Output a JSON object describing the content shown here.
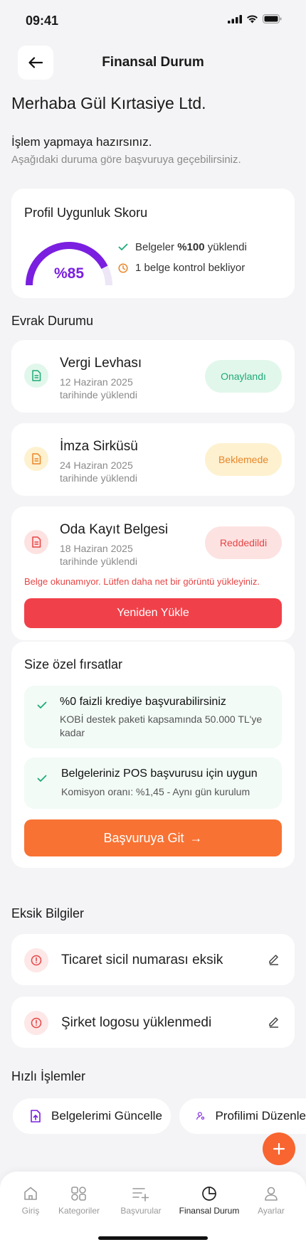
{
  "status": {
    "time": "09:41"
  },
  "header": {
    "title": "Finansal Durum"
  },
  "greeting": "Merhaba Gül Kırtasiye Ltd.",
  "intro": {
    "title": "İşlem yapmaya hazırsınız.",
    "subtitle": "Aşağıdaki duruma göre başvuruya geçebilirsiniz."
  },
  "score": {
    "title": "Profil Uygunluk Skoru",
    "value_label": "%85",
    "value": 0.85,
    "line1_prefix": "Belgeler",
    "line1_bold": "%100",
    "line1_suffix": "yüklendi",
    "line2": "1 belge kontrol bekliyor"
  },
  "documents": {
    "title": "Evrak Durumu",
    "items": [
      {
        "name": "Vergi Levhası",
        "date": "12 Haziran 2025 tarihinde yüklendi",
        "status": "Onaylandı",
        "color": "#1eaa78",
        "bg": "#e2f7ec"
      },
      {
        "name": "İmza Sirküsü",
        "date": "24 Haziran 2025 tarihinde yüklendi",
        "status": "Beklemede",
        "color": "#e8862a",
        "bg": "#fdf1cf"
      },
      {
        "name": "Oda Kayıt Belgesi",
        "date": "18 Haziran 2025 tarihinde yüklendi",
        "status": "Reddedildi",
        "color": "#e64545",
        "bg": "#fde2e2"
      }
    ],
    "reject_message": "Belge okunamıyor. Lütfen daha net bir görüntü yükleyiniz.",
    "reupload_label": "Yeniden Yükle"
  },
  "opportunities": {
    "title": "Size özel fırsatlar",
    "items": [
      {
        "title": "%0 faizli krediye başvurabilirsiniz",
        "body": "KOBİ destek paketi kapsamında 50.000 TL'ye kadar"
      },
      {
        "title": "Belgeleriniz POS başvurusu için uygun",
        "body": "Komisyon oranı: %1,45 - Aynı gün kurulum"
      }
    ],
    "apply_label": "Başvuruya Git",
    "apply_arrow": "→"
  },
  "missing": {
    "title": "Eksik Bilgiler",
    "items": [
      {
        "text": "Ticaret sicil numarası eksik"
      },
      {
        "text": "Şirket logosu yüklenmedi"
      }
    ]
  },
  "quick": {
    "title": "Hızlı İşlemler",
    "items": [
      {
        "label": "Belgelerimi Güncelle"
      },
      {
        "label": "Profilimi Düzenle"
      }
    ]
  },
  "tabs": [
    {
      "label": "Giriş",
      "icon": "home-icon"
    },
    {
      "label": "Kategoriler",
      "icon": "categories-icon"
    },
    {
      "label": "Başvurular",
      "icon": "list-add-icon"
    },
    {
      "label": "Finansal Durum",
      "icon": "pie-chart-icon",
      "active": true
    },
    {
      "label": "Ayarlar",
      "icon": "user-icon"
    }
  ],
  "colors": {
    "accent": "#f87233",
    "purple": "#7a1fe0",
    "danger": "#f0414a",
    "success": "#1eaa78"
  }
}
